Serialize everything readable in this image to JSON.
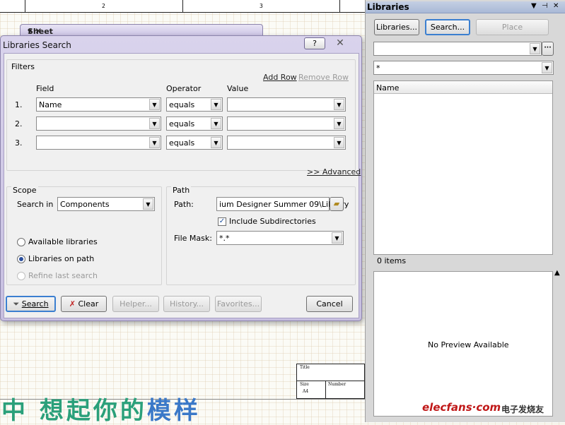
{
  "schematic": {
    "ruler_numbers": [
      "2",
      "3"
    ],
    "sheet_title": "Sheet",
    "title_block": {
      "title_label": "Title",
      "size_label": "Size",
      "size_value": "A4",
      "number_label": "Number"
    },
    "banner_text_green": "中 想起你的",
    "banner_text_blue": "模样"
  },
  "dialog": {
    "title": "Libraries Search",
    "help_glyph": "?",
    "close_glyph": "✕",
    "filters": {
      "group_label": "Filters",
      "add_row": "Add Row",
      "remove_row": "Remove Row",
      "col_field": "Field",
      "col_operator": "Operator",
      "col_value": "Value",
      "rows": [
        {
          "num": "1.",
          "field": "Name",
          "operator": "equals",
          "value": ""
        },
        {
          "num": "2.",
          "field": "",
          "operator": "equals",
          "value": ""
        },
        {
          "num": "3.",
          "field": "",
          "operator": "equals",
          "value": ""
        }
      ],
      "advanced": ">> Advanced"
    },
    "scope": {
      "group_label": "Scope",
      "search_in_label": "Search in",
      "search_in_value": "Components",
      "options": [
        "Available libraries",
        "Libraries on path",
        "Refine last search"
      ],
      "selected_option": "Libraries on path"
    },
    "path": {
      "group_label": "Path",
      "path_label": "Path:",
      "path_value": "ium Designer Summer 09\\Library",
      "include_subdirs": "Include Subdirectories",
      "include_subdirs_checked": true,
      "file_mask_label": "File Mask:",
      "file_mask_value": "*.*"
    },
    "buttons": {
      "search": "Search",
      "clear": "Clear",
      "helper": "Helper...",
      "history": "History...",
      "favorites": "Favorites...",
      "cancel": "Cancel"
    }
  },
  "panel": {
    "title": "Libraries",
    "buttons": {
      "libraries": "Libraries...",
      "search": "Search...",
      "place": "Place"
    },
    "library_combo_value": "",
    "more_glyph": "···",
    "filter_value": "*",
    "column_name": "Name",
    "items_count": "0 items",
    "preview_text": "No Preview Available",
    "watermark_logo": "elecfans·com",
    "watermark_cn": "电子发烧友"
  }
}
